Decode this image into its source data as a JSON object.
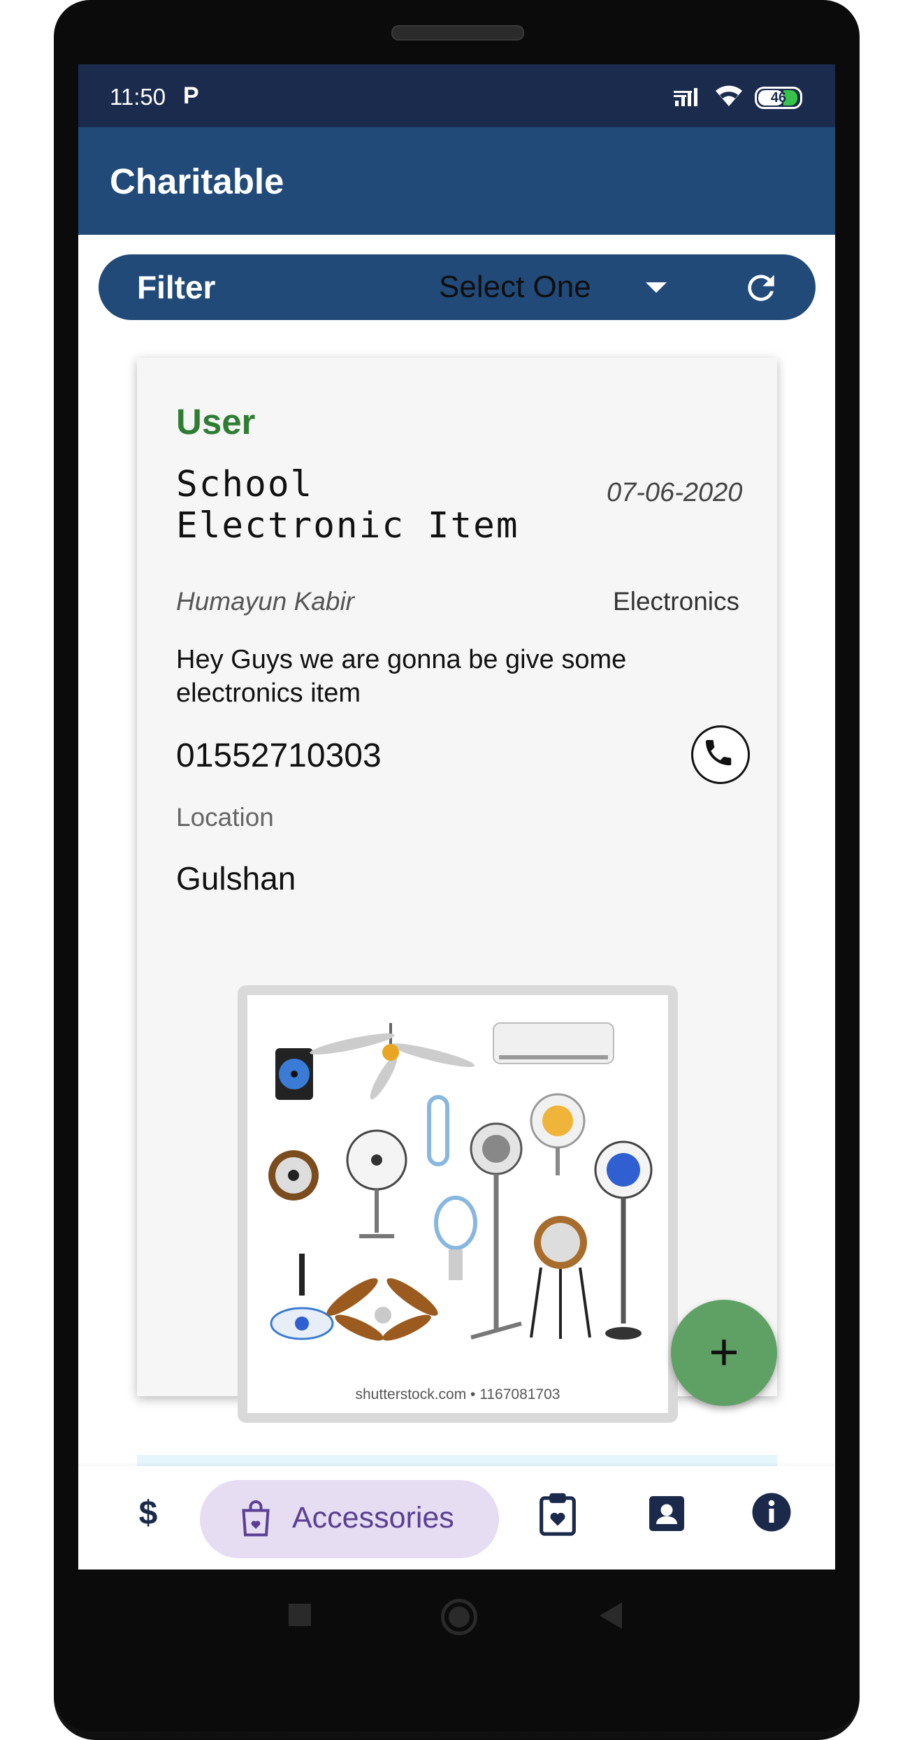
{
  "status_bar": {
    "time": "11:50",
    "notification_icon": "parking-p-icon",
    "battery_level": "46",
    "icons": [
      "signal-icon",
      "wifi-icon",
      "battery-icon"
    ]
  },
  "app_bar": {
    "title": "Charitable"
  },
  "filter": {
    "label": "Filter",
    "selected_value": "Select One",
    "icons": [
      "dropdown-caret-icon",
      "refresh-icon"
    ]
  },
  "post": {
    "role": "User",
    "title": "School Electronic Item",
    "title_lines": [
      "School",
      "Electronic Item"
    ],
    "date": "07-06-2020",
    "author": "Humayun Kabir",
    "category": "Electronics",
    "description": "Hey Guys we are gonna be give some electronics item",
    "phone": "01552710303",
    "location_label": "Location",
    "location": "Gulshan",
    "image_credit": "shutterstock.com • 1167081703"
  },
  "fab": {
    "label": "+"
  },
  "bottom_nav": {
    "items": [
      {
        "icon": "dollar-icon",
        "label": "$"
      },
      {
        "icon": "shopping-bag-icon",
        "label": "Accessories",
        "active": true
      },
      {
        "icon": "clipboard-heart-icon"
      },
      {
        "icon": "contact-card-icon"
      },
      {
        "icon": "info-icon"
      }
    ]
  },
  "colors": {
    "status_bar": "#1a2b4d",
    "app_bar": "#214a78",
    "role_green": "#2f7d32",
    "fab": "#5fa064",
    "nav_pill": "#e6ddf3",
    "nav_active_text": "#5a3f93"
  }
}
